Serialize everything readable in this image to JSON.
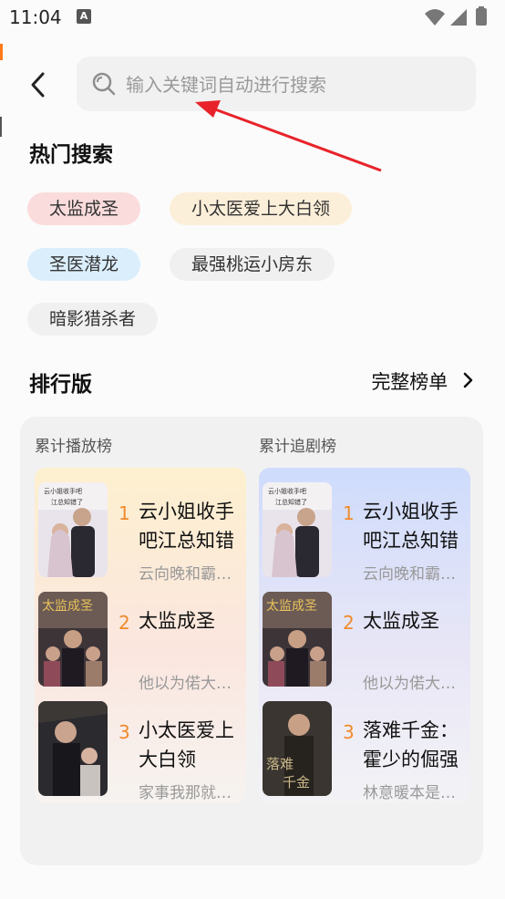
{
  "status_bar": {
    "time": "11:04",
    "app_badge": "A"
  },
  "search": {
    "placeholder": "输入关键词自动进行搜索"
  },
  "hot_search": {
    "title": "热门搜索",
    "chips": [
      {
        "label": "太监成圣",
        "bg": "#fbdcdc"
      },
      {
        "label": "小太医爱上大白领",
        "bg": "#fcefd9"
      },
      {
        "label": "圣医潜龙",
        "bg": "#dbeefc"
      },
      {
        "label": "最强桃运小房东",
        "bg": "#f0f0f0"
      },
      {
        "label": "暗影猎杀者",
        "bg": "#f0f0f0"
      }
    ]
  },
  "ranking": {
    "title": "排行版",
    "full_list_label": "完整榜单",
    "columns": [
      {
        "title": "累计播放榜",
        "items": [
          {
            "rank": "1",
            "title": "云小姐收手吧江总知错",
            "desc": "云向晚和霸…"
          },
          {
            "rank": "2",
            "title": "太监成圣",
            "desc": "他以为偌大…"
          },
          {
            "rank": "3",
            "title": "小太医爱上大白领",
            "desc": "家事我那就…"
          }
        ]
      },
      {
        "title": "累计追剧榜",
        "items": [
          {
            "rank": "1",
            "title": "云小姐收手吧江总知错",
            "desc": "云向晚和霸…"
          },
          {
            "rank": "2",
            "title": "太监成圣",
            "desc": "他以为偌大…"
          },
          {
            "rank": "3",
            "title": "落难千金：霍少的倔强",
            "desc": "林意暖本是…"
          }
        ]
      }
    ]
  },
  "colors": {
    "accent_rank": "#f08a2c",
    "annotation_arrow": "#e8232a"
  }
}
